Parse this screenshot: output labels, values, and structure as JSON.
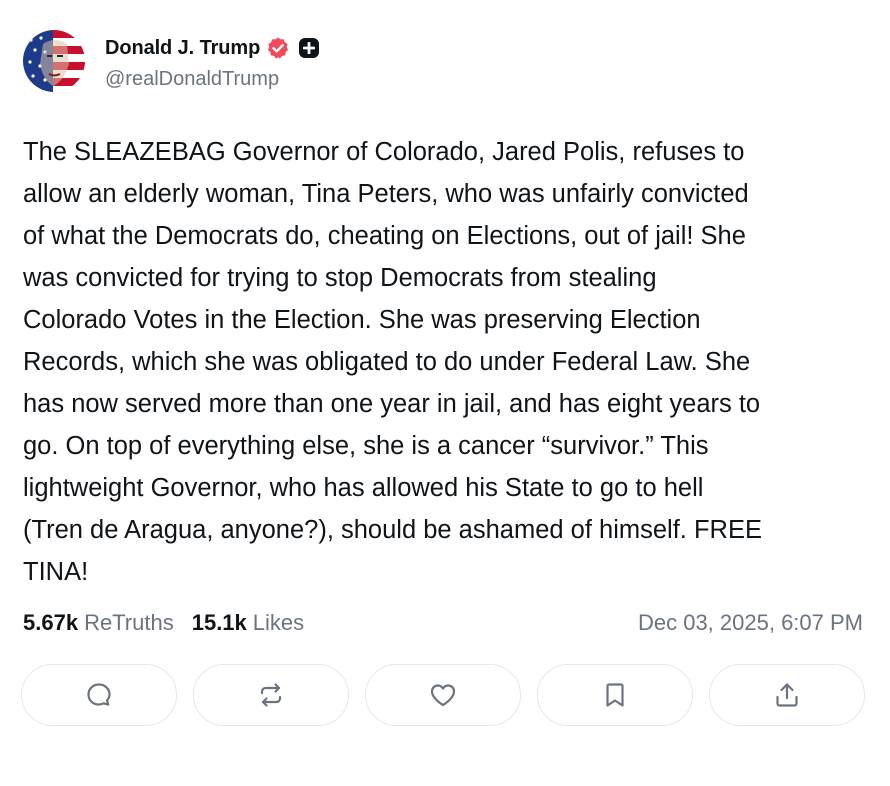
{
  "author": {
    "display_name": "Donald J. Trump",
    "handle": "@realDonaldTrump",
    "verified_icon": "verified-badge-icon",
    "verified_color": "#ef4b5b",
    "extra_icon": "truth-plus-icon"
  },
  "post": {
    "text": "The SLEAZEBAG Governor of Colorado, Jared Polis, refuses to\nallow an elderly woman, Tina Peters, who was unfairly convicted\nof what the Democrats do, cheating on Elections, out of jail! She\nwas convicted for trying to stop Democrats from stealing\nColorado Votes in the Election. She was preserving Election\nRecords, which she was obligated to do under Federal Law. She\nhas now served more than one year in jail, and has eight years to\ngo. On top of everything else, she is a cancer “survivor.” This\nlightweight Governor, who has allowed his State to go to hell\n(Tren de Aragua, anyone?), should be ashamed of himself. FREE\nTINA!"
  },
  "stats": {
    "retruths_count": "5.67k",
    "retruths_label": "ReTruths",
    "likes_count": "15.1k",
    "likes_label": "Likes",
    "timestamp": "Dec 03, 2025, 6:07 PM"
  },
  "actions": [
    {
      "icon": "reply-icon"
    },
    {
      "icon": "retruth-icon"
    },
    {
      "icon": "like-icon"
    },
    {
      "icon": "bookmark-icon"
    },
    {
      "icon": "share-icon"
    }
  ],
  "colors": {
    "text": "#0f1419",
    "muted": "#6b7280",
    "border": "#e5e7eb",
    "icon": "#6b7280"
  }
}
